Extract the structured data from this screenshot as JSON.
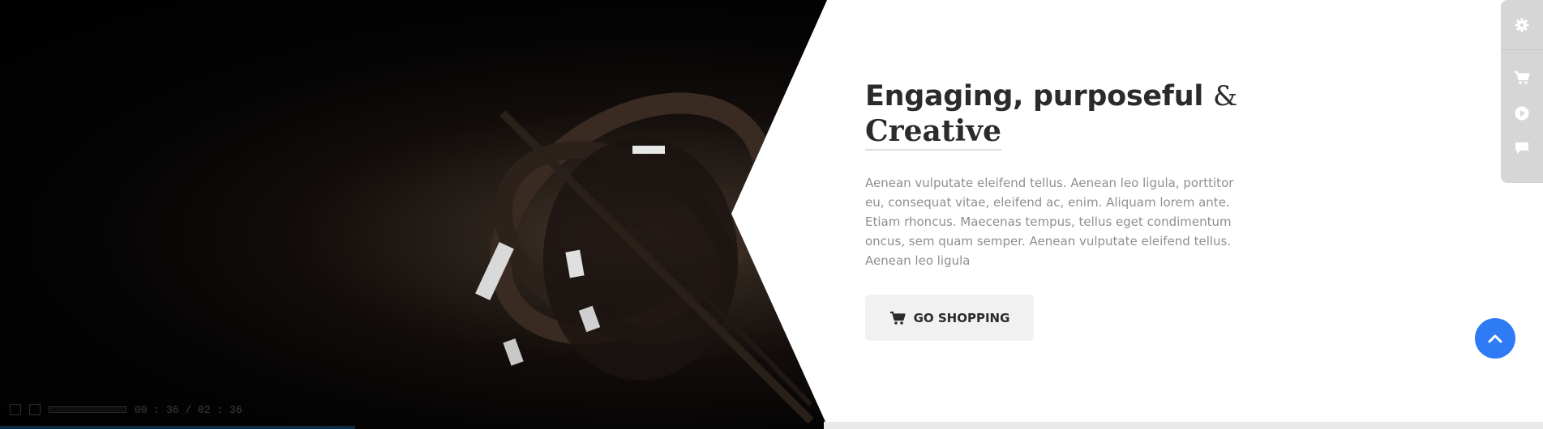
{
  "video": {
    "time": "00 : 36 / 02 : 36",
    "progress": 0.23
  },
  "hero": {
    "heading_bold": "Engaging, purposeful",
    "heading_amp": "&",
    "heading_script": "Creative",
    "description": "Aenean vulputate eleifend tellus. Aenean leo ligula, porttitor eu, consequat vitae, eleifend ac, enim. Aliquam lorem ante. Etiam rhoncus. Maecenas tempus, tellus eget condimentum oncus, sem quam semper. Aenean vulputate eleifend tellus. Aenean leo ligula",
    "cta_label": "GO SHOPPING",
    "cta_icon": "cart-icon"
  },
  "side_panel": {
    "items": [
      "gear-icon",
      "cart-icon",
      "play-icon",
      "comment-icon"
    ]
  },
  "colors": {
    "accent": "#2f7bf5",
    "heading": "#2b2b2b",
    "body_text": "#8f8f8f",
    "button_bg": "#f1f1f1",
    "panel_bg": "#d6d6d6"
  }
}
